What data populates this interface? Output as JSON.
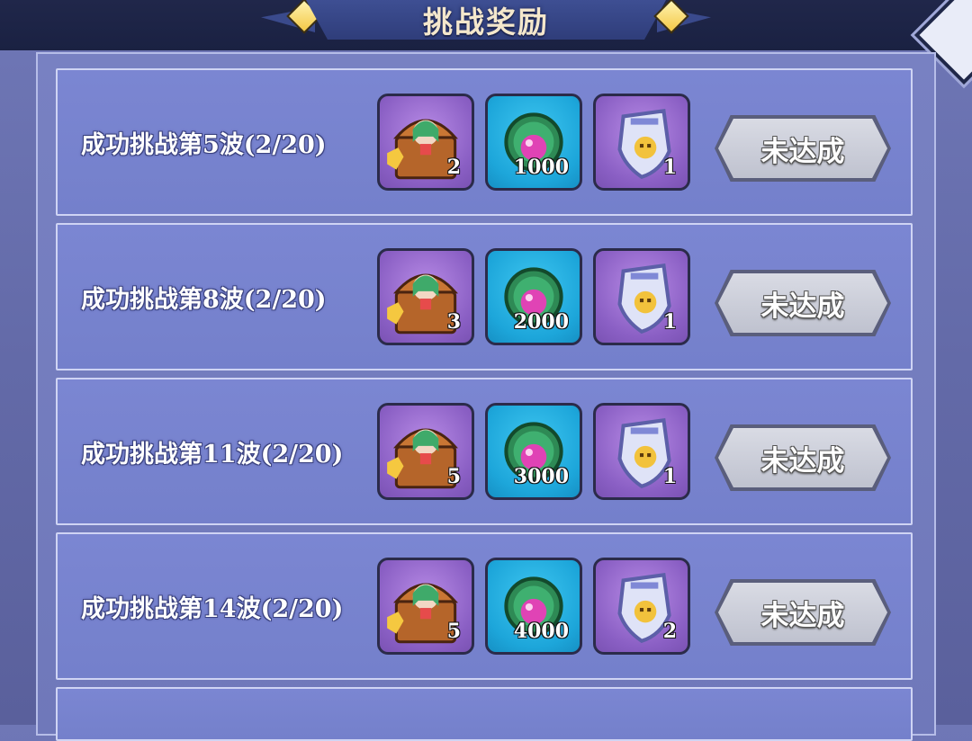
{
  "header": {
    "title": "挑战奖励"
  },
  "rows": [
    {
      "title": "成功挑战第5波(2/20)",
      "rewards": [
        {
          "icon": "treasure-chest-icon",
          "qty": "2",
          "bg": "purple"
        },
        {
          "icon": "gem-orb-icon",
          "qty": "1000",
          "bg": "blue"
        },
        {
          "icon": "badge-shield-icon",
          "qty": "1",
          "bg": "purple"
        }
      ],
      "status": "未达成"
    },
    {
      "title": "成功挑战第8波(2/20)",
      "rewards": [
        {
          "icon": "treasure-chest-icon",
          "qty": "3",
          "bg": "purple"
        },
        {
          "icon": "gem-orb-icon",
          "qty": "2000",
          "bg": "blue"
        },
        {
          "icon": "badge-shield-icon",
          "qty": "1",
          "bg": "purple"
        }
      ],
      "status": "未达成"
    },
    {
      "title": "成功挑战第11波(2/20)",
      "rewards": [
        {
          "icon": "treasure-chest-icon",
          "qty": "5",
          "bg": "purple"
        },
        {
          "icon": "gem-orb-icon",
          "qty": "3000",
          "bg": "blue"
        },
        {
          "icon": "badge-shield-icon",
          "qty": "1",
          "bg": "purple"
        }
      ],
      "status": "未达成"
    },
    {
      "title": "成功挑战第14波(2/20)",
      "rewards": [
        {
          "icon": "treasure-chest-icon",
          "qty": "5",
          "bg": "purple"
        },
        {
          "icon": "gem-orb-icon",
          "qty": "4000",
          "bg": "blue"
        },
        {
          "icon": "badge-shield-icon",
          "qty": "2",
          "bg": "purple"
        }
      ],
      "status": "未达成"
    }
  ],
  "colors": {
    "panel": "#7881c2",
    "row": "#7b86d2",
    "topbar": "#1d2445",
    "status_button": "#c9cbd6"
  }
}
